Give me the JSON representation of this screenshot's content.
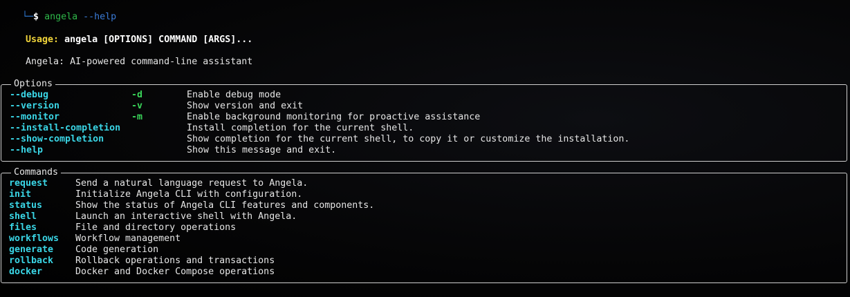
{
  "prompt": {
    "corner": "└─",
    "dollar": "$",
    "command": "angela",
    "argument": "--help"
  },
  "usage": {
    "label": "Usage:",
    "text": "angela [OPTIONS] COMMAND [ARGS]..."
  },
  "description": "Angela: AI-powered command-line assistant",
  "options": {
    "title": "Options",
    "items": [
      {
        "name": "--debug",
        "short": "-d",
        "help": "Enable debug mode"
      },
      {
        "name": "--version",
        "short": "-v",
        "help": "Show version and exit"
      },
      {
        "name": "--monitor",
        "short": "-m",
        "help": "Enable background monitoring for proactive assistance"
      },
      {
        "name": "--install-completion",
        "short": "",
        "help": "Install completion for the current shell."
      },
      {
        "name": "--show-completion",
        "short": "",
        "help": "Show completion for the current shell, to copy it or customize the installation."
      },
      {
        "name": "--help",
        "short": "",
        "help": "Show this message and exit."
      }
    ]
  },
  "commands": {
    "title": "Commands",
    "items": [
      {
        "name": "request",
        "help": "Send a natural language request to Angela."
      },
      {
        "name": "init",
        "help": "Initialize Angela CLI with configuration."
      },
      {
        "name": "status",
        "help": "Show the status of Angela CLI features and components."
      },
      {
        "name": "shell",
        "help": "Launch an interactive shell with Angela."
      },
      {
        "name": "files",
        "help": "File and directory operations"
      },
      {
        "name": "workflows",
        "help": "Workflow management"
      },
      {
        "name": "generate",
        "help": "Code generation"
      },
      {
        "name": "rollback",
        "help": "Rollback operations and transactions"
      },
      {
        "name": "docker",
        "help": "Docker and Docker Compose operations"
      }
    ]
  }
}
